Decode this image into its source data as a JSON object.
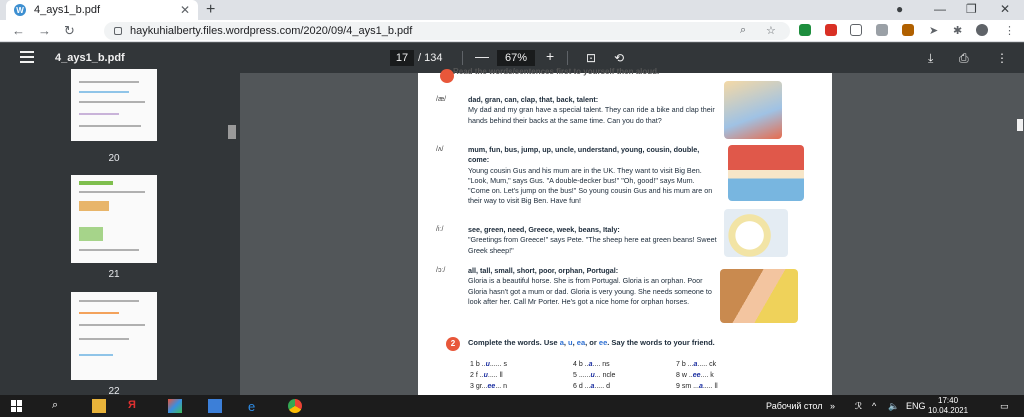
{
  "browser": {
    "tab_title": "4_ays1_b.pdf",
    "tab_favicon": "W",
    "url": "haykuhialberty.files.wordpress.com/2020/09/4_ays1_b.pdf"
  },
  "pdf": {
    "file_name": "4_ays1_b.pdf",
    "page_current": "17",
    "page_total": "/ 134",
    "zoom": "67%",
    "zoom_minus": "—",
    "zoom_plus": "+"
  },
  "thumbnails": [
    {
      "label": "20"
    },
    {
      "label": "21"
    },
    {
      "label": "22"
    }
  ],
  "document": {
    "top_cut_text": "Read the words/sentences first to yourself then aloud.",
    "sections": [
      {
        "symbol": "/æ/",
        "words": "dad, gran, can, clap, that, back, talent:",
        "text": "My dad and my gran have a special talent. They can ride a bike and clap their hands behind their backs at the same time. Can you do that?"
      },
      {
        "symbol": "/ʌ/",
        "words": "mum, fun, bus, jump, up, uncle, understand, young, cousin, double, come:",
        "text": "Young cousin Gus and his mum are in the UK. They want to visit Big Ben. \"Look, Mum,\" says Gus. \"A double-decker bus!\" \"Oh, good!\" says Mum. \"Come on. Let's jump on the bus!\" So young cousin Gus and his mum are on their way to visit Big Ben. Have fun!"
      },
      {
        "symbol": "/iː/",
        "words": "see, green, need, Greece, week, beans, Italy:",
        "text": "\"Greetings from Greece!\" says Pete. \"The sheep here eat green beans! Sweet Greek sheep!\""
      },
      {
        "symbol": "/ɔː/",
        "words": "all, tall, small, short, poor, orphan, Portugal:",
        "text": "Gloria is a beautiful horse. She is from Portugal. Gloria is an orphan. Poor Gloria hasn't got a mum or dad. Gloria is very young. She needs someone to look after her. Call Mr Porter. He's got a nice home for orphan horses."
      }
    ],
    "task_number": "2",
    "task_before": "Complete the words. Use ",
    "task_a": "a",
    "task_comma1": ", ",
    "task_u": "u",
    "task_comma2": ", ",
    "task_ea": "ea",
    "task_or": ", or ",
    "task_ee": "ee",
    "task_after": ". Say the words to your friend.",
    "exercise": [
      [
        {
          "pre": "1  b ..",
          "fill": "u",
          "post": "...... s"
        },
        {
          "pre": "4  b ..",
          "fill": "a",
          "post": ".... ns"
        },
        {
          "pre": "7  b ...",
          "fill": "a",
          "post": "..... ck"
        }
      ],
      [
        {
          "pre": "2  f ..",
          "fill": "u",
          "post": "..... ll"
        },
        {
          "pre": "5  ......",
          "fill": "u",
          "post": "... ncle"
        },
        {
          "pre": "8  w ..",
          "fill": "ee",
          "post": ".... k"
        }
      ],
      [
        {
          "pre": "3  gr...",
          "fill": "ee",
          "post": "... n"
        },
        {
          "pre": "6  d ...",
          "fill": "a",
          "post": "..... d"
        },
        {
          "pre": "9  sm ...",
          "fill": "a",
          "post": "..... ll"
        }
      ]
    ]
  },
  "taskbar": {
    "desktop_label": "Рабочий стол",
    "lang": "ENG",
    "time": "17:40",
    "date": "10.04.2021",
    "chevron": "»"
  },
  "colors": {
    "pdf_toolbar": "#323639",
    "viewer_bg": "#525659",
    "accent_red": "#e8573a",
    "accent_blue": "#2d6fd2"
  }
}
